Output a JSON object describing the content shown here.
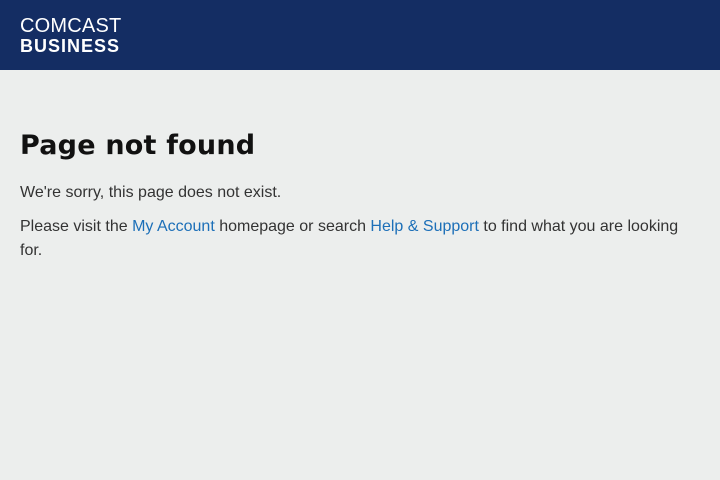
{
  "header": {
    "logo_line1": "COMCAST",
    "logo_line2": "BUSINESS"
  },
  "main": {
    "title": "Page not found",
    "sorry_text": "We're sorry, this page does not exist.",
    "visit_prefix": "Please visit the ",
    "my_account_link": "My Account",
    "visit_middle": " homepage or search ",
    "help_link": "Help & Support",
    "visit_suffix": " to find what you are looking for."
  },
  "colors": {
    "header_bg": "#142d63",
    "page_bg": "#eceeed",
    "link": "#1c6fb8"
  }
}
